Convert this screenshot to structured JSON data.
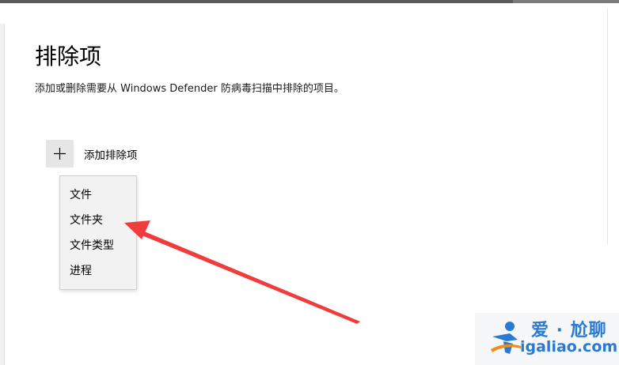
{
  "page": {
    "title": "排除项",
    "description": "添加或删除需要从 Windows Defender 防病毒扫描中排除的项目。"
  },
  "add_button": {
    "icon": "plus-icon",
    "label": "添加排除项"
  },
  "context_menu": {
    "items": [
      {
        "label": "文件"
      },
      {
        "label": "文件夹"
      },
      {
        "label": "文件类型"
      },
      {
        "label": "进程"
      }
    ],
    "highlighted_item": "文件夹"
  },
  "annotation": {
    "arrow_color": "#f03c3c"
  },
  "watermark": {
    "name": "爱 · 尬聊",
    "url": "igaliao.com",
    "color": "#2a7ad2"
  }
}
